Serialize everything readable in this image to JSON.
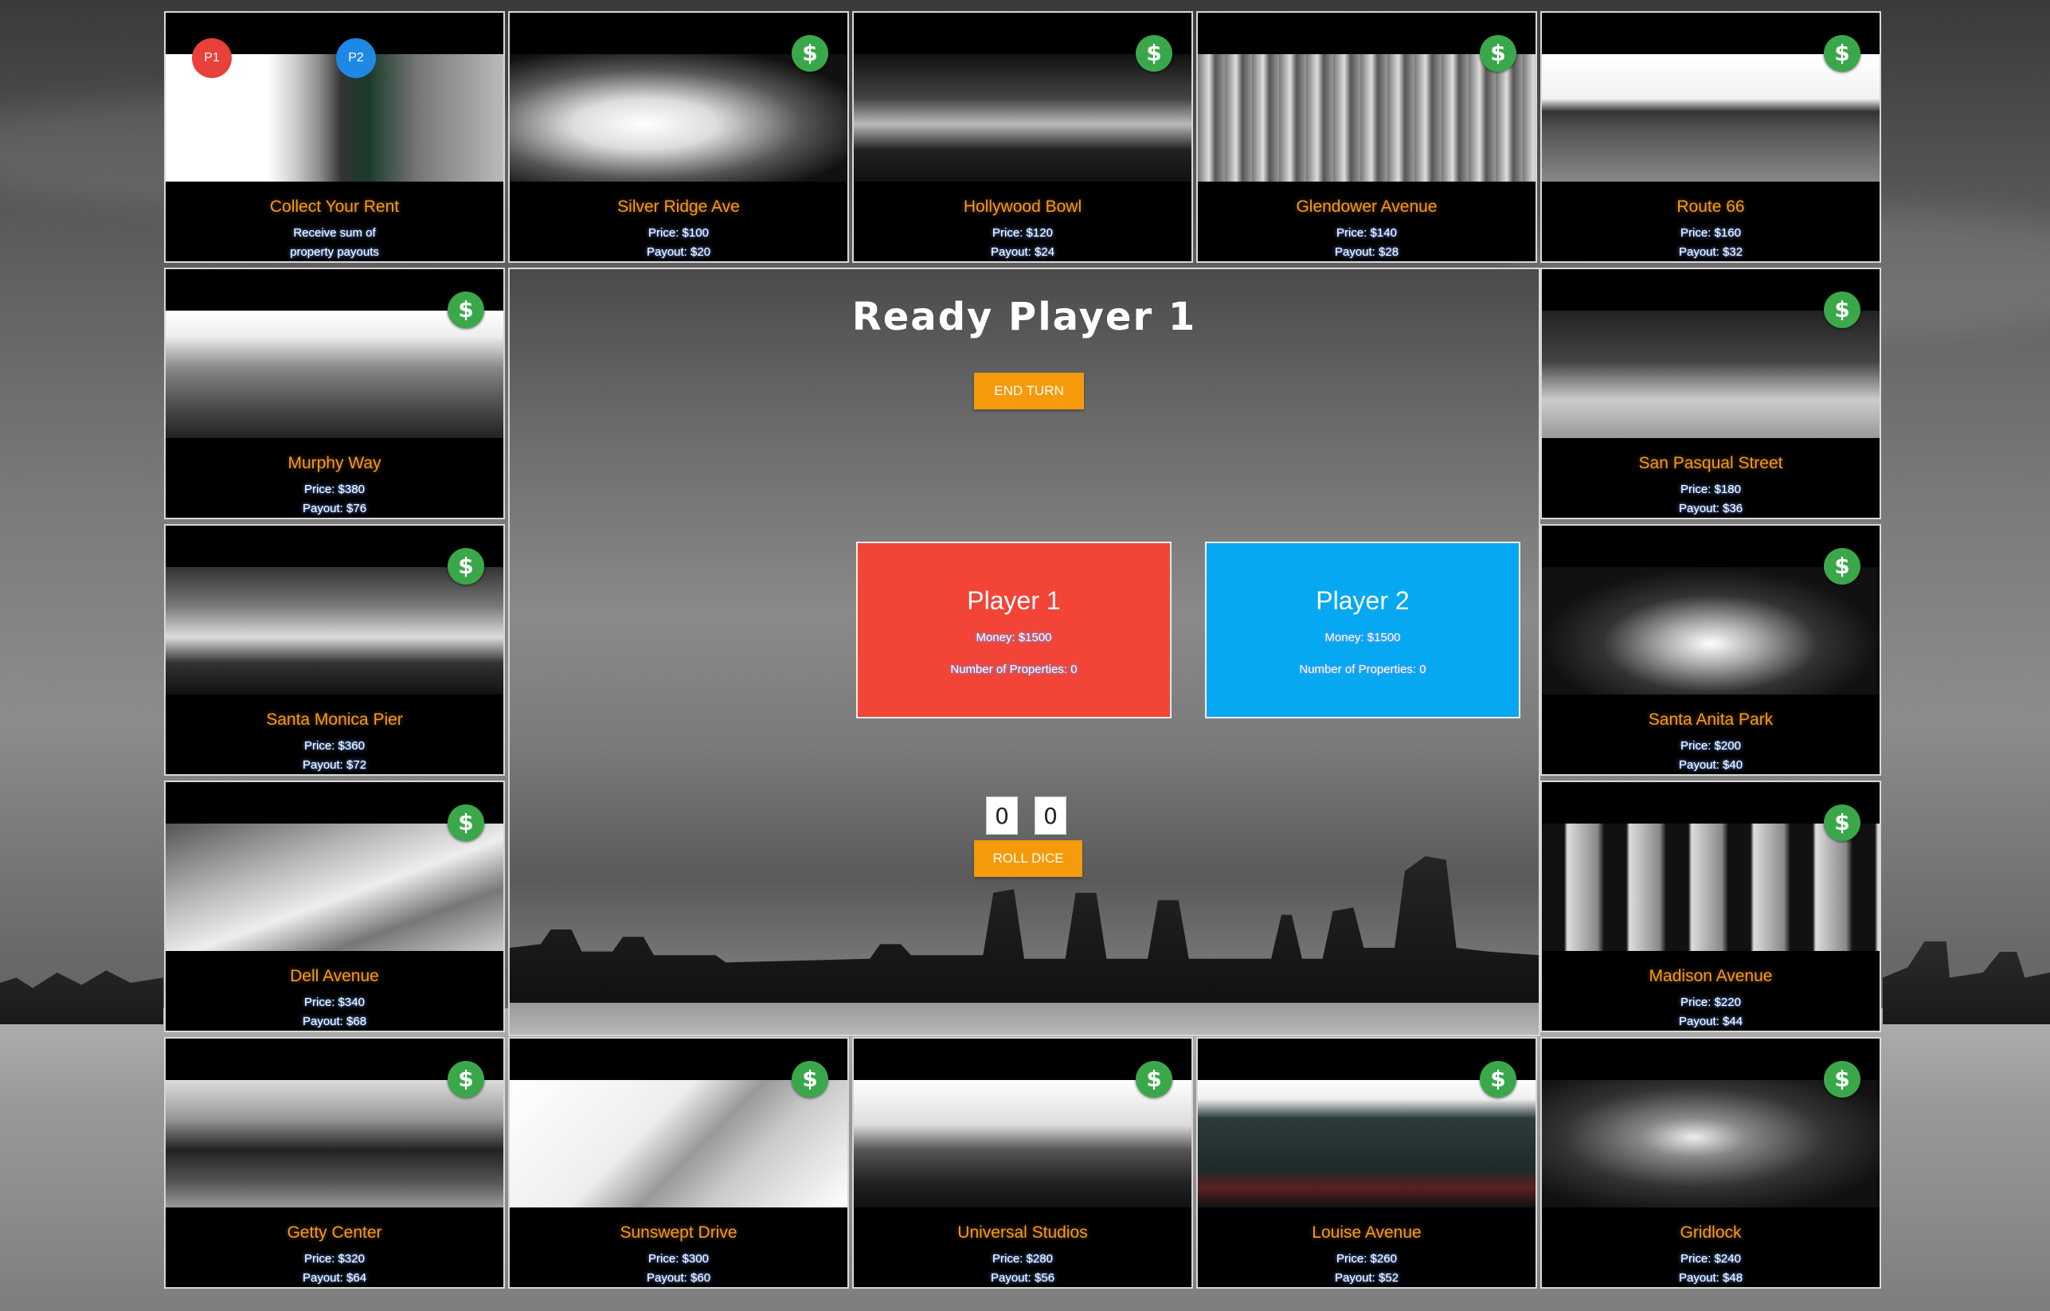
{
  "status": {
    "title": "Ready Player 1"
  },
  "buttons": {
    "end_turn": "END TURN",
    "roll_dice": "ROLL DICE"
  },
  "dice": [
    "0",
    "0"
  ],
  "players": [
    {
      "name": "Player 1",
      "money": "Money: $1500",
      "properties": "Number of Properties: 0",
      "token": "P1",
      "color": "#f24437"
    },
    {
      "name": "Player 2",
      "money": "Money: $1500",
      "properties": "Number of Properties: 0",
      "token": "P2",
      "color": "#06a8f2"
    }
  ],
  "purchase_icon": {
    "name": "dollar-icon",
    "glyph": "$",
    "color": "#3aa84a"
  },
  "tiles": [
    {
      "name": "Collect Your Rent",
      "line1": "Receive sum of",
      "line2": "property payouts"
    },
    {
      "name": "Silver Ridge Ave",
      "line1": "Price: $100",
      "line2": "Payout: $20"
    },
    {
      "name": "Hollywood Bowl",
      "line1": "Price: $120",
      "line2": "Payout: $24"
    },
    {
      "name": "Glendower Avenue",
      "line1": "Price: $140",
      "line2": "Payout: $28"
    },
    {
      "name": "Route 66",
      "line1": "Price: $160",
      "line2": "Payout: $32"
    },
    {
      "name": "San Pasqual Street",
      "line1": "Price: $180",
      "line2": "Payout: $36"
    },
    {
      "name": "Santa Anita Park",
      "line1": "Price: $200",
      "line2": "Payout: $40"
    },
    {
      "name": "Madison Avenue",
      "line1": "Price: $220",
      "line2": "Payout: $44"
    },
    {
      "name": "Gridlock",
      "line1": "Price: $240",
      "line2": "Payout: $48"
    },
    {
      "name": "Louise Avenue",
      "line1": "Price: $260",
      "line2": "Payout: $52"
    },
    {
      "name": "Universal Studios",
      "line1": "Price: $280",
      "line2": "Payout: $56"
    },
    {
      "name": "Sunswept Drive",
      "line1": "Price: $300",
      "line2": "Payout: $60"
    },
    {
      "name": "Getty Center",
      "line1": "Price: $320",
      "line2": "Payout: $64"
    },
    {
      "name": "Dell Avenue",
      "line1": "Price: $340",
      "line2": "Payout: $68"
    },
    {
      "name": "Santa Monica Pier",
      "line1": "Price: $360",
      "line2": "Payout: $72"
    },
    {
      "name": "Murphy Way",
      "line1": "Price: $380",
      "line2": "Payout: $76"
    }
  ]
}
